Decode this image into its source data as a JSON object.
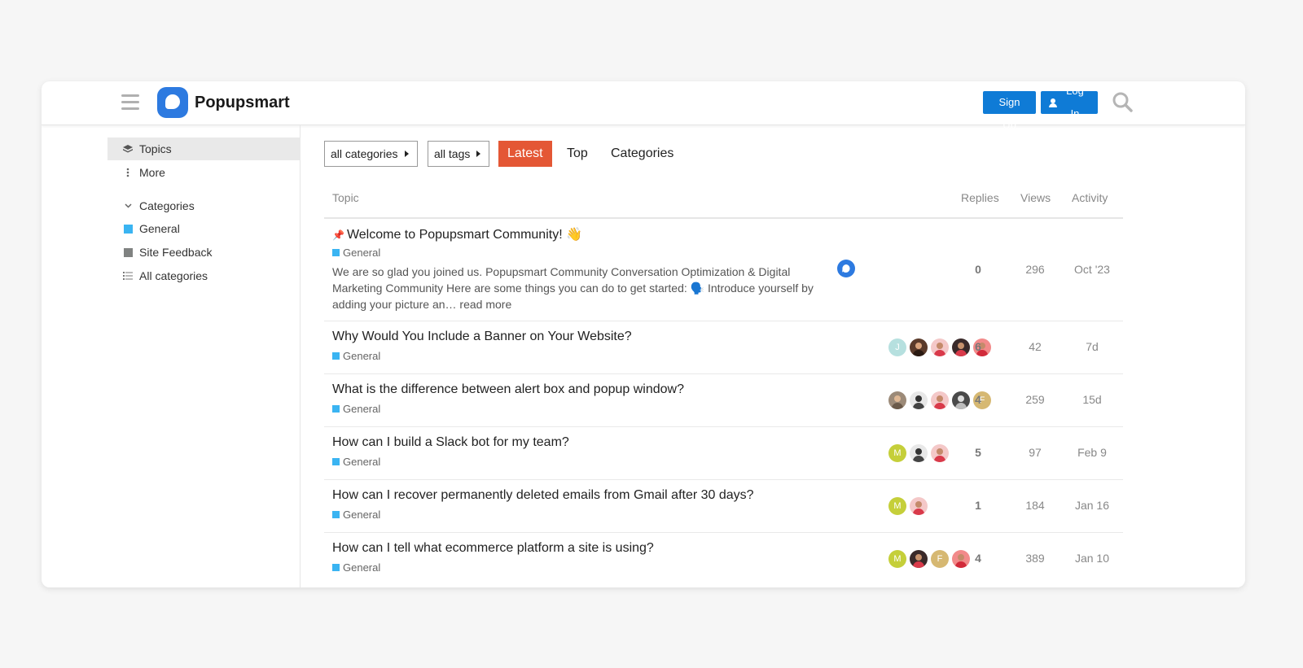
{
  "header": {
    "logo_text": "Popupsmart",
    "sign_up": "Sign Up",
    "log_in": "Log In"
  },
  "sidebar": {
    "topics": "Topics",
    "more": "More",
    "categories_header": "Categories",
    "items": [
      {
        "label": "General",
        "color": "#3ab4f2"
      },
      {
        "label": "Site Feedback",
        "color": "#808281"
      },
      {
        "label": "All categories"
      }
    ]
  },
  "filters": {
    "categories": "all categories",
    "tags": "all tags"
  },
  "tabs": [
    "Latest",
    "Top",
    "Categories"
  ],
  "table": {
    "headers": {
      "topic": "Topic",
      "replies": "Replies",
      "views": "Views",
      "activity": "Activity"
    },
    "rows": [
      {
        "title": "Welcome to Popupsmart Community! 👋",
        "pinned": true,
        "category": "General",
        "excerpt": "We are so glad you joined us. Popupsmart Community Conversation Optimization & Digital Marketing Community Here are some things you can do to get started: 🗣️ Introduce yourself by adding your picture an… read more",
        "replies": "0",
        "views": "296",
        "activity": "Oct '23",
        "avatars": [
          "logo"
        ]
      },
      {
        "title": "Why Would You Include a Banner on Your Website?",
        "category": "General",
        "replies": "6",
        "views": "42",
        "activity": "7d",
        "avatars": [
          "J",
          "photo-dark",
          "photo-red",
          "photo-dark",
          "photo-red"
        ]
      },
      {
        "title": "What is the difference between alert box and popup window?",
        "category": "General",
        "replies": "4",
        "views": "259",
        "activity": "15d",
        "avatars": [
          "photo-tan",
          "photo-dark",
          "photo-red",
          "photo-dark",
          "F"
        ]
      },
      {
        "title": "How can I build a Slack bot for my team?",
        "category": "General",
        "replies": "5",
        "views": "97",
        "activity": "Feb 9",
        "avatars": [
          "M",
          "photo-dark",
          "photo-red"
        ]
      },
      {
        "title": "How can I recover permanently deleted emails from Gmail after 30 days?",
        "category": "General",
        "replies": "1",
        "views": "184",
        "activity": "Jan 16",
        "avatars": [
          "M",
          "photo-red"
        ]
      },
      {
        "title": "How can I tell what ecommerce platform a site is using?",
        "category": "General",
        "replies": "4",
        "views": "389",
        "activity": "Jan 10",
        "avatars": [
          "M",
          "photo-dark",
          "F",
          "photo-red"
        ]
      }
    ]
  }
}
